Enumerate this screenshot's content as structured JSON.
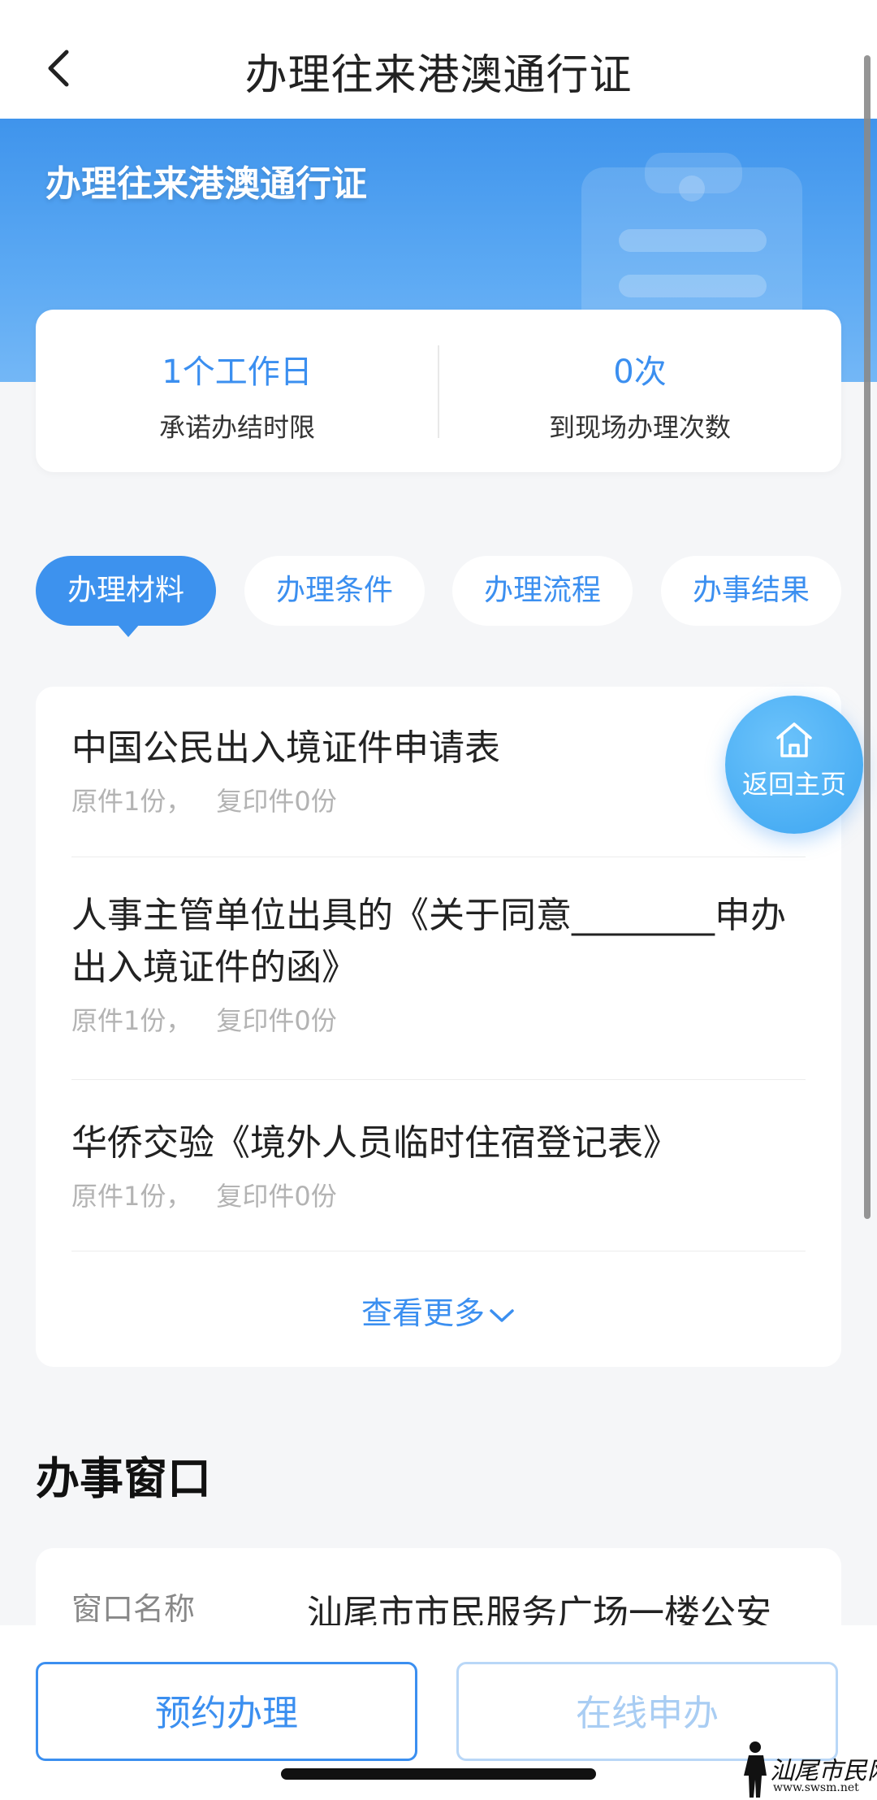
{
  "nav": {
    "title": "办理往来港澳通行证",
    "back_icon": "chevron-left-icon"
  },
  "banner": {
    "title": "办理往来港澳通行证"
  },
  "stats": [
    {
      "value": "1个工作日",
      "label": "承诺办结时限"
    },
    {
      "value": "0次",
      "label": "到现场办理次数"
    }
  ],
  "tabs": [
    {
      "label": "办理材料",
      "active": true
    },
    {
      "label": "办理条件",
      "active": false
    },
    {
      "label": "办理流程",
      "active": false
    },
    {
      "label": "办事结果",
      "active": false
    }
  ],
  "materials": [
    {
      "name": "中国公民出入境证件申请表",
      "original": "原件1份，",
      "copy": "复印件0份"
    },
    {
      "name": "人事主管单位出具的《关于同意________申办出入境证件的函》",
      "original": "原件1份，",
      "copy": "复印件0份"
    },
    {
      "name": "华侨交验《境外人员临时住宿登记表》",
      "original": "原件1份，",
      "copy": "复印件0份"
    }
  ],
  "more_label": "查看更多",
  "home_fab": {
    "label": "返回主页",
    "icon": "home-icon"
  },
  "section": {
    "title": "办事窗口"
  },
  "window": {
    "label": "窗口名称",
    "value": "汕尾市市民服务广场一楼公安"
  },
  "bottom": {
    "primary": "预约办理",
    "secondary": "在线申办"
  },
  "watermark": {
    "text": "汕尾市民网",
    "url": "www.swsm.net"
  },
  "colors": {
    "accent": "#3b8ff0",
    "banner": "#4a9df0"
  }
}
